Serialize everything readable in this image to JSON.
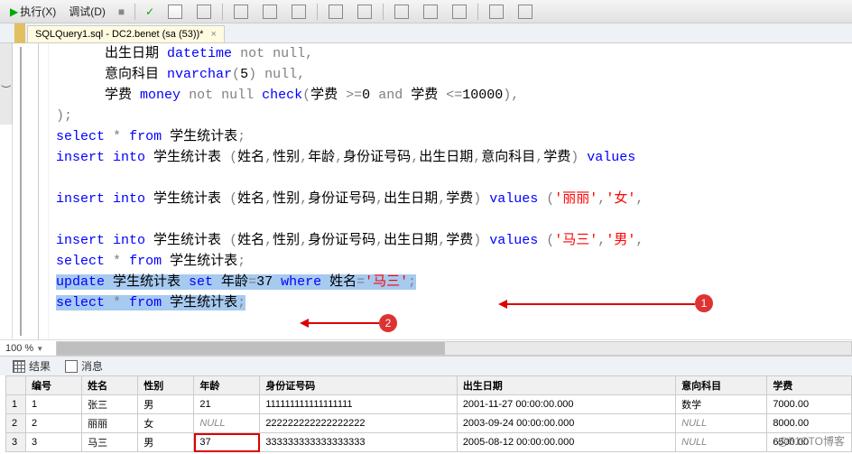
{
  "toolbar": {
    "execute_label": "执行(X)",
    "debug_label": "调试(D)"
  },
  "tab": {
    "title": "SQLQuery1.sql - DC2.benet (sa (53))*",
    "dirty": "*",
    "close": "×"
  },
  "code_lines": [
    {
      "indent": 3,
      "tokens": [
        {
          "t": "出生日期 ",
          "c": ""
        },
        {
          "t": "datetime",
          "c": "kw-blue"
        },
        {
          "t": " ",
          "c": ""
        },
        {
          "t": "not null",
          "c": "kw-gray"
        },
        {
          "t": ",",
          "c": "kw-gray"
        }
      ]
    },
    {
      "indent": 3,
      "tokens": [
        {
          "t": "意向科目 ",
          "c": ""
        },
        {
          "t": "nvarchar",
          "c": "kw-blue"
        },
        {
          "t": "(",
          "c": "kw-gray"
        },
        {
          "t": "5",
          "c": ""
        },
        {
          "t": ") ",
          "c": "kw-gray"
        },
        {
          "t": "null",
          "c": "kw-gray"
        },
        {
          "t": ",",
          "c": "kw-gray"
        }
      ]
    },
    {
      "indent": 3,
      "tokens": [
        {
          "t": "学费 ",
          "c": ""
        },
        {
          "t": "money",
          "c": "kw-blue"
        },
        {
          "t": " ",
          "c": ""
        },
        {
          "t": "not null",
          "c": "kw-gray"
        },
        {
          "t": " ",
          "c": ""
        },
        {
          "t": "check",
          "c": "kw-blue"
        },
        {
          "t": "(",
          "c": "kw-gray"
        },
        {
          "t": "学费 ",
          "c": ""
        },
        {
          "t": ">=",
          "c": "kw-gray"
        },
        {
          "t": "0",
          "c": ""
        },
        {
          "t": " ",
          "c": ""
        },
        {
          "t": "and",
          "c": "kw-gray"
        },
        {
          "t": " 学费 ",
          "c": ""
        },
        {
          "t": "<=",
          "c": "kw-gray"
        },
        {
          "t": "10000",
          "c": ""
        },
        {
          "t": "),",
          "c": "kw-gray"
        }
      ]
    },
    {
      "indent": 0,
      "tokens": [
        {
          "t": ");",
          "c": "kw-gray"
        }
      ]
    },
    {
      "indent": 0,
      "tokens": [
        {
          "t": "select",
          "c": "kw-blue"
        },
        {
          "t": " ",
          "c": ""
        },
        {
          "t": "*",
          "c": "kw-gray"
        },
        {
          "t": " ",
          "c": ""
        },
        {
          "t": "from",
          "c": "kw-blue"
        },
        {
          "t": " 学生统计表",
          "c": ""
        },
        {
          "t": ";",
          "c": "kw-gray"
        }
      ]
    },
    {
      "indent": 0,
      "tokens": [
        {
          "t": "insert",
          "c": "kw-blue"
        },
        {
          "t": " ",
          "c": ""
        },
        {
          "t": "into",
          "c": "kw-blue"
        },
        {
          "t": " 学生统计表 ",
          "c": ""
        },
        {
          "t": "(",
          "c": "kw-gray"
        },
        {
          "t": "姓名",
          "c": ""
        },
        {
          "t": ",",
          "c": "kw-gray"
        },
        {
          "t": "性别",
          "c": ""
        },
        {
          "t": ",",
          "c": "kw-gray"
        },
        {
          "t": "年龄",
          "c": ""
        },
        {
          "t": ",",
          "c": "kw-gray"
        },
        {
          "t": "身份证号码",
          "c": ""
        },
        {
          "t": ",",
          "c": "kw-gray"
        },
        {
          "t": "出生日期",
          "c": ""
        },
        {
          "t": ",",
          "c": "kw-gray"
        },
        {
          "t": "意向科目",
          "c": ""
        },
        {
          "t": ",",
          "c": "kw-gray"
        },
        {
          "t": "学费",
          "c": ""
        },
        {
          "t": ") ",
          "c": "kw-gray"
        },
        {
          "t": "values",
          "c": "kw-blue"
        }
      ]
    },
    {
      "indent": 0,
      "tokens": [
        {
          "t": " ",
          "c": ""
        }
      ]
    },
    {
      "indent": 0,
      "tokens": [
        {
          "t": "insert",
          "c": "kw-blue"
        },
        {
          "t": " ",
          "c": ""
        },
        {
          "t": "into",
          "c": "kw-blue"
        },
        {
          "t": " 学生统计表 ",
          "c": ""
        },
        {
          "t": "(",
          "c": "kw-gray"
        },
        {
          "t": "姓名",
          "c": ""
        },
        {
          "t": ",",
          "c": "kw-gray"
        },
        {
          "t": "性别",
          "c": ""
        },
        {
          "t": ",",
          "c": "kw-gray"
        },
        {
          "t": "身份证号码",
          "c": ""
        },
        {
          "t": ",",
          "c": "kw-gray"
        },
        {
          "t": "出生日期",
          "c": ""
        },
        {
          "t": ",",
          "c": "kw-gray"
        },
        {
          "t": "学费",
          "c": ""
        },
        {
          "t": ") ",
          "c": "kw-gray"
        },
        {
          "t": "values",
          "c": "kw-blue"
        },
        {
          "t": " ",
          "c": ""
        },
        {
          "t": "(",
          "c": "kw-gray"
        },
        {
          "t": "'丽丽'",
          "c": "kw-red"
        },
        {
          "t": ",",
          "c": "kw-gray"
        },
        {
          "t": "'女'",
          "c": "kw-red"
        },
        {
          "t": ",",
          "c": "kw-gray"
        }
      ]
    },
    {
      "indent": 0,
      "tokens": [
        {
          "t": " ",
          "c": ""
        }
      ]
    },
    {
      "indent": 0,
      "tokens": [
        {
          "t": "insert",
          "c": "kw-blue"
        },
        {
          "t": " ",
          "c": ""
        },
        {
          "t": "into",
          "c": "kw-blue"
        },
        {
          "t": " 学生统计表 ",
          "c": ""
        },
        {
          "t": "(",
          "c": "kw-gray"
        },
        {
          "t": "姓名",
          "c": ""
        },
        {
          "t": ",",
          "c": "kw-gray"
        },
        {
          "t": "性别",
          "c": ""
        },
        {
          "t": ",",
          "c": "kw-gray"
        },
        {
          "t": "身份证号码",
          "c": ""
        },
        {
          "t": ",",
          "c": "kw-gray"
        },
        {
          "t": "出生日期",
          "c": ""
        },
        {
          "t": ",",
          "c": "kw-gray"
        },
        {
          "t": "学费",
          "c": ""
        },
        {
          "t": ") ",
          "c": "kw-gray"
        },
        {
          "t": "values",
          "c": "kw-blue"
        },
        {
          "t": " ",
          "c": ""
        },
        {
          "t": "(",
          "c": "kw-gray"
        },
        {
          "t": "'马三'",
          "c": "kw-red"
        },
        {
          "t": ",",
          "c": "kw-gray"
        },
        {
          "t": "'男'",
          "c": "kw-red"
        },
        {
          "t": ",",
          "c": "kw-gray"
        }
      ]
    },
    {
      "indent": 0,
      "tokens": [
        {
          "t": "select",
          "c": "kw-blue"
        },
        {
          "t": " ",
          "c": ""
        },
        {
          "t": "*",
          "c": "kw-gray"
        },
        {
          "t": " ",
          "c": ""
        },
        {
          "t": "from",
          "c": "kw-blue"
        },
        {
          "t": " 学生统计表",
          "c": ""
        },
        {
          "t": ";",
          "c": "kw-gray"
        }
      ]
    },
    {
      "indent": 0,
      "hl": true,
      "tokens": [
        {
          "t": "update",
          "c": "kw-blue"
        },
        {
          "t": " 学生统计表 ",
          "c": ""
        },
        {
          "t": "set",
          "c": "kw-blue"
        },
        {
          "t": " 年龄",
          "c": ""
        },
        {
          "t": "=",
          "c": "kw-gray"
        },
        {
          "t": "37",
          "c": ""
        },
        {
          "t": " ",
          "c": ""
        },
        {
          "t": "where",
          "c": "kw-blue"
        },
        {
          "t": " 姓名",
          "c": ""
        },
        {
          "t": "=",
          "c": "kw-gray"
        },
        {
          "t": "'马三'",
          "c": "kw-red"
        },
        {
          "t": ";",
          "c": "kw-gray"
        }
      ]
    },
    {
      "indent": 0,
      "hl": true,
      "tokens": [
        {
          "t": "select",
          "c": "kw-blue"
        },
        {
          "t": " ",
          "c": ""
        },
        {
          "t": "*",
          "c": "kw-gray"
        },
        {
          "t": " ",
          "c": ""
        },
        {
          "t": "from",
          "c": "kw-blue"
        },
        {
          "t": " 学生统计表",
          "c": ""
        },
        {
          "t": ";",
          "c": "kw-gray"
        }
      ]
    }
  ],
  "zoom": "100 %",
  "results_tabs": {
    "results": "结果",
    "messages": "消息"
  },
  "grid": {
    "columns": [
      "",
      "编号",
      "姓名",
      "性别",
      "年龄",
      "身份证号码",
      "出生日期",
      "意向科目",
      "学费"
    ],
    "rows": [
      [
        "1",
        "1",
        "张三",
        "男",
        "21",
        "111111111111111111",
        "2001-11-27 00:00:00.000",
        "数学",
        "7000.00"
      ],
      [
        "2",
        "2",
        "丽丽",
        "女",
        "NULL",
        "222222222222222222",
        "2003-09-24 00:00:00.000",
        "NULL",
        "8000.00"
      ],
      [
        "3",
        "3",
        "马三",
        "男",
        "37",
        "333333333333333333",
        "2005-08-12 00:00:00.000",
        "NULL",
        "6500.00"
      ]
    ]
  },
  "annotations": {
    "badge1": "1",
    "badge2": "2"
  },
  "watermark": "@51CTO博客",
  "left_tool_hint": ")"
}
